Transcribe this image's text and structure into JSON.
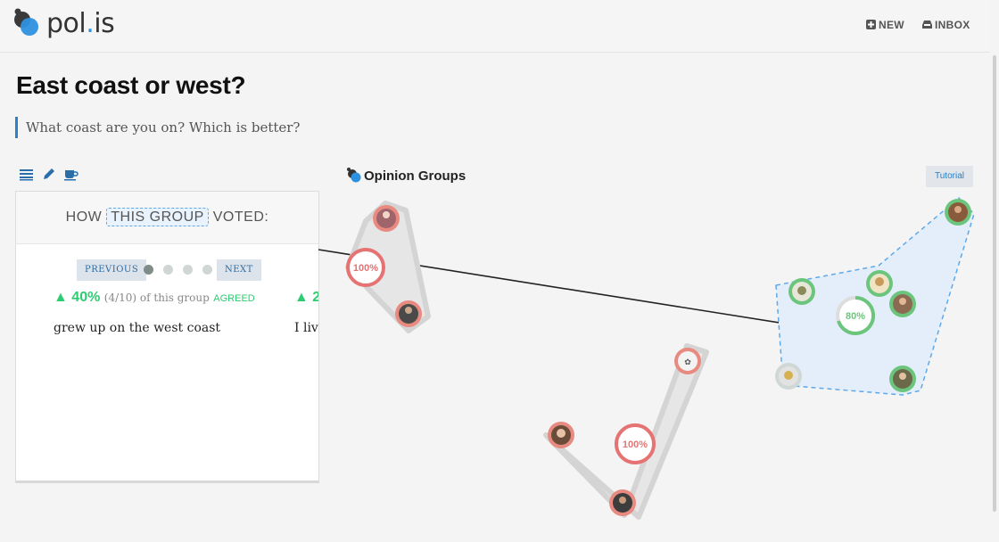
{
  "app": {
    "brand_prefix": "pol",
    "brand_dot": ".",
    "brand_suffix": "is"
  },
  "nav": {
    "new_label": "NEW",
    "inbox_label": "INBOX"
  },
  "conversation": {
    "title": "East coast or west?",
    "description": "What coast are you on? Which is better?"
  },
  "toolbar": {
    "icons": [
      "list-icon",
      "pencil-icon",
      "coffee-icon"
    ]
  },
  "group_panel": {
    "header_prefix": "HOW",
    "header_group": "THIS GROUP",
    "header_suffix": "VOTED:",
    "previous_label": "PREVIOUS",
    "next_label": "NEXT",
    "pages": 4,
    "active_page": 1,
    "stat_arrow": "▲",
    "stat_percent": "40%",
    "stat_detail": "(4/10) of this group",
    "stat_verb": "AGREED",
    "comment": "grew up on the west coast",
    "next_stat_partial": "▲ 2",
    "next_comment_partial": "I live"
  },
  "opinion_groups": {
    "title": "Opinion Groups",
    "tutorial_label": "Tutorial",
    "groups": [
      {
        "id": "group-a",
        "percent": "100%",
        "selected": false
      },
      {
        "id": "group-b",
        "percent": "100%",
        "selected": false
      },
      {
        "id": "group-c",
        "percent": "80%",
        "selected": true
      }
    ]
  },
  "colors": {
    "accent": "#2e91e0",
    "agree": "#2ecc71",
    "disagree_ring": "#e57373",
    "agree_ring": "#6cc57c",
    "selected_hull": "#e3eefa"
  }
}
